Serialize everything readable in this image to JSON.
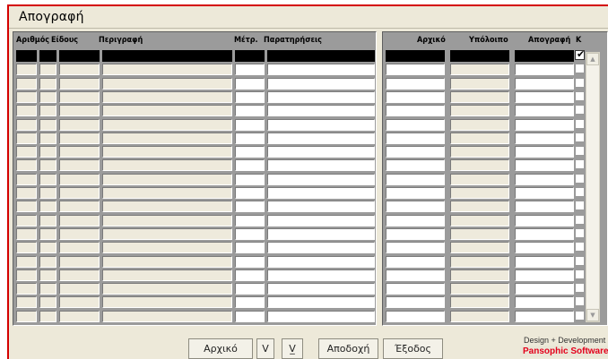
{
  "window": {
    "title": "Απογραφή"
  },
  "left_table": {
    "headers": [
      "Αριθμός",
      "Είδους",
      "Περιγραφή",
      "Μέτρ.",
      "Παρατηρήσεις"
    ]
  },
  "right_table": {
    "headers": [
      "Αρχικό",
      "Υπόλοιπο",
      "Απογραφή",
      "Κ"
    ]
  },
  "rows": [
    {
      "selected": true,
      "k": true
    },
    {
      "k": false
    },
    {
      "k": false
    },
    {
      "k": false
    },
    {
      "k": false
    },
    {
      "k": false
    },
    {
      "k": false
    },
    {
      "k": false
    },
    {
      "k": false
    },
    {
      "k": false
    },
    {
      "k": false
    },
    {
      "k": false
    },
    {
      "k": false
    },
    {
      "k": false
    },
    {
      "k": false
    },
    {
      "k": false
    },
    {
      "k": false
    },
    {
      "k": false
    },
    {
      "k": false
    },
    {
      "k": false
    }
  ],
  "buttons": {
    "initial": "Αρχικό",
    "down": "V",
    "down_all": "V̲",
    "accept": "Αποδοχή",
    "exit": "Έξοδος"
  },
  "credits": {
    "line1": "Design + Development",
    "line2": "Pansophic Software"
  },
  "colors": {
    "frame_red": "#d40000",
    "panel_gray": "#9b9b9b",
    "credit_red": "#e3001b"
  }
}
